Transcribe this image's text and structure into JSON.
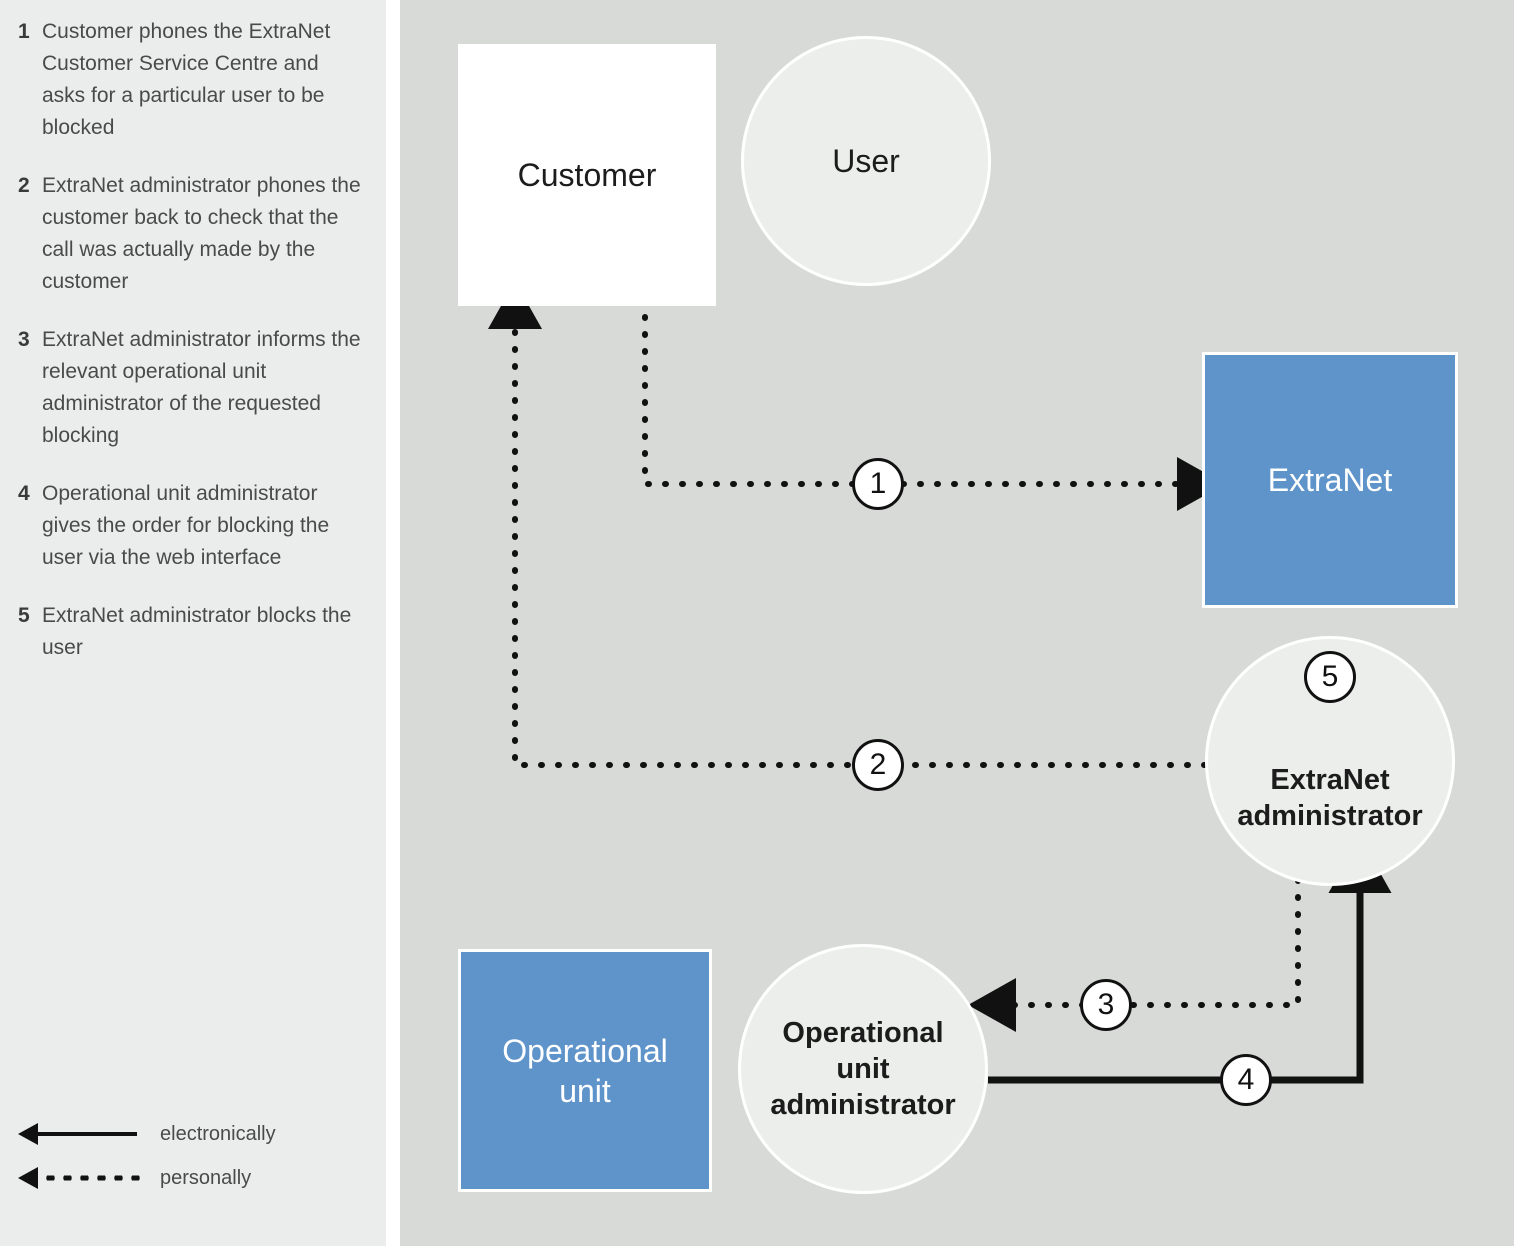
{
  "sidebar": {
    "steps": [
      {
        "num": "1",
        "text": "Customer phones the ExtraNet Customer Service Centre and asks for a particular user to be blocked"
      },
      {
        "num": "2",
        "text": "ExtraNet administrator phones the customer back to check that the call was actually made by the customer"
      },
      {
        "num": "3",
        "text": "ExtraNet administrator informs the relevant operational unit administrator of the requested blocking"
      },
      {
        "num": "4",
        "text": "Operational unit administrator gives the order for blocking the user via the web interface"
      },
      {
        "num": "5",
        "text": "ExtraNet administrator blocks the user"
      }
    ],
    "legend": [
      {
        "style": "solid",
        "label": "electronically"
      },
      {
        "style": "dotted",
        "label": "personally"
      }
    ]
  },
  "diagram": {
    "nodes": {
      "customer": "Customer",
      "user": "User",
      "extranet": "ExtraNet",
      "extranet_admin_line1": "ExtraNet",
      "extranet_admin_line2": "administrator",
      "operational_unit_line1": "Operational",
      "operational_unit_line2": "unit",
      "operational_unit_admin_line1": "Operational",
      "operational_unit_admin_line2": "unit",
      "operational_unit_admin_line3": "administrator"
    },
    "badges": {
      "one": "1",
      "two": "2",
      "three": "3",
      "four": "4",
      "five": "5"
    },
    "colors": {
      "panel_background": "#ebeded",
      "diagram_background": "#d8dad8",
      "accent_blue": "#5f94ca",
      "node_grey": "#eceeec",
      "node_white": "#ffffff",
      "line": "#111111",
      "text": "#4a4a4a"
    }
  }
}
